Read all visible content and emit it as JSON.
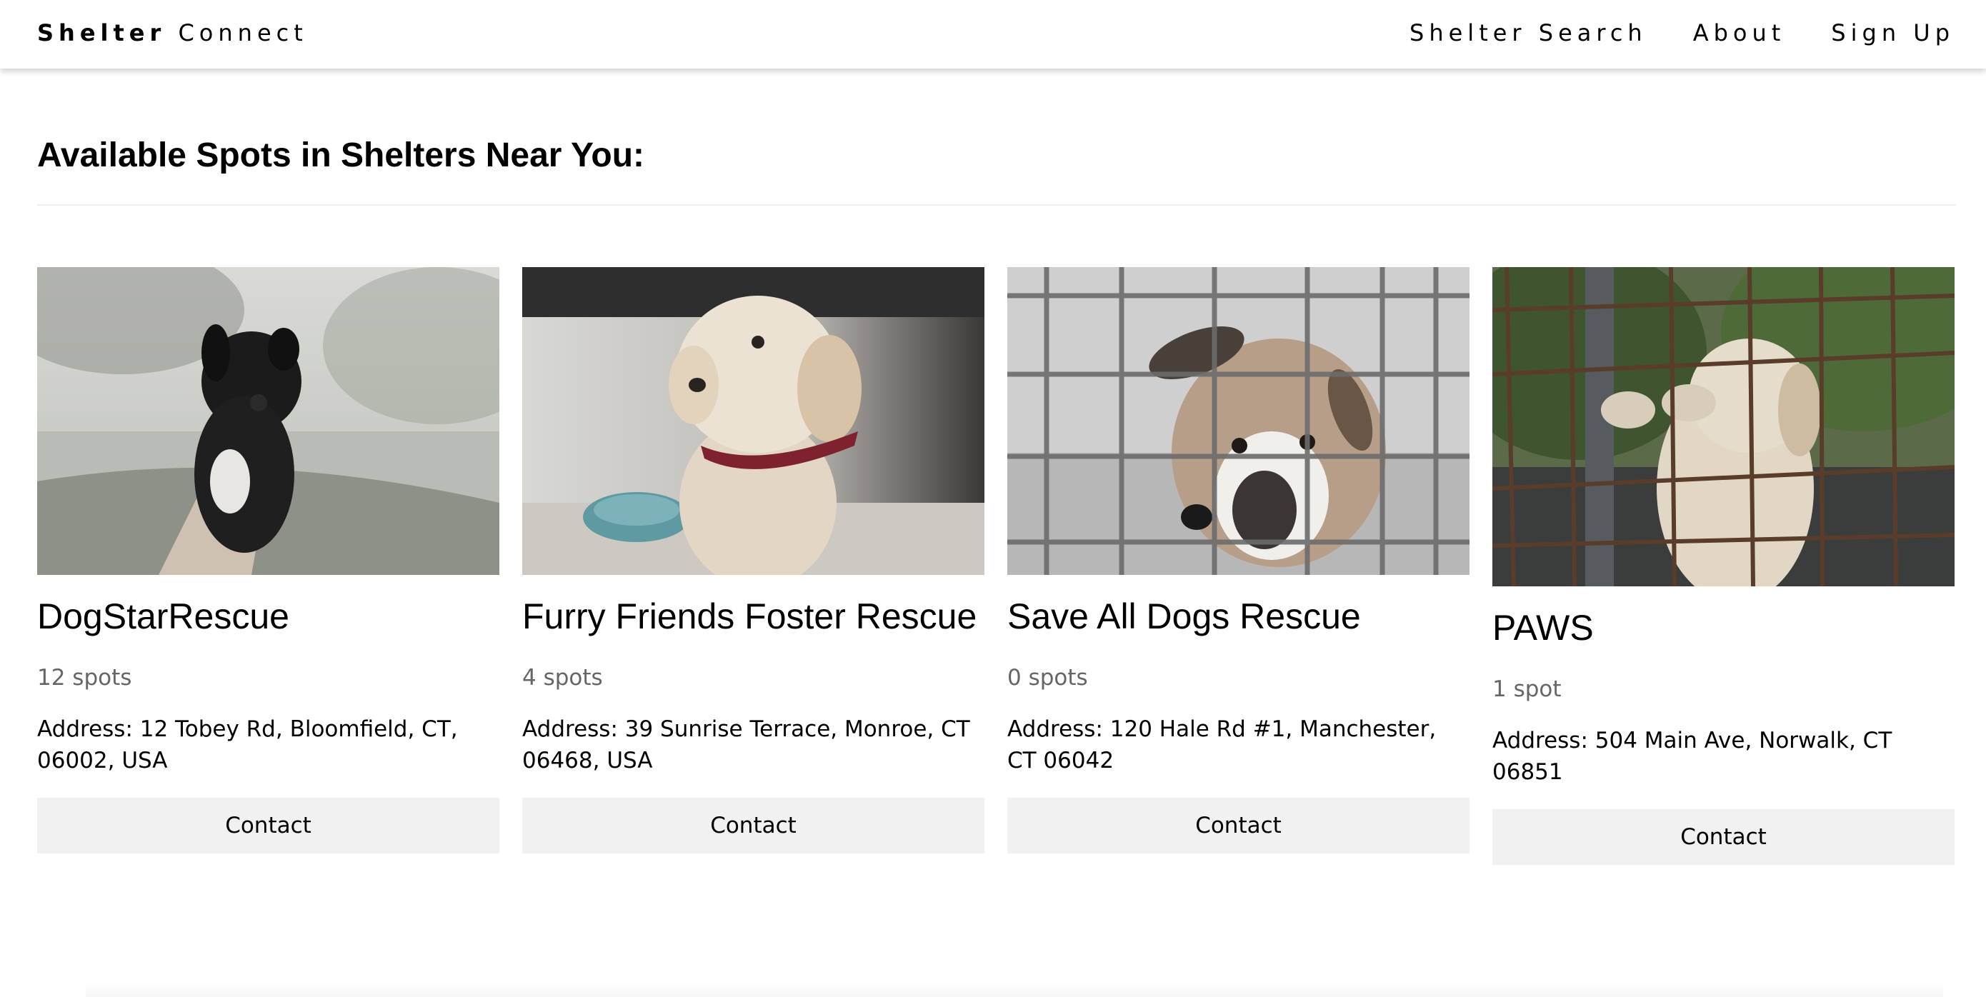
{
  "header": {
    "brand_bold": "Shelter",
    "brand_rest": "Connect",
    "nav": [
      {
        "label": "Shelter Search"
      },
      {
        "label": "About"
      },
      {
        "label": "Sign Up"
      }
    ]
  },
  "main": {
    "heading": "Available Spots in Shelters Near You:",
    "shelters": [
      {
        "name": "DogStarRescue",
        "spots": "12 spots",
        "address": "Address: 12 Tobey Rd, Bloomfield, CT, 06002, USA",
        "contact_label": "Contact",
        "image": "black-puppy-held-in-hand-photo"
      },
      {
        "name": "Furry Friends Foster Rescue",
        "spots": "4 spots",
        "address": "Address: 39 Sunrise Terrace, Monroe, CT 06468, USA",
        "contact_label": "Contact",
        "image": "golden-puppy-with-red-collar-photo"
      },
      {
        "name": "Save All Dogs Rescue",
        "spots": "0 spots",
        "address": "Address: 120 Hale Rd #1, Manchester, CT 06042",
        "contact_label": "Contact",
        "image": "dog-behind-wire-cage-photo"
      },
      {
        "name": "PAWS",
        "spots": "1 spot",
        "address": "Address: 504 Main Ave, Norwalk, CT 06851",
        "contact_label": "Contact",
        "image": "dog-paws-on-rusty-fence-photo"
      }
    ]
  },
  "colors": {
    "button_bg": "#f1f1f1",
    "muted_text": "#666666",
    "divider": "#eeeeee"
  }
}
